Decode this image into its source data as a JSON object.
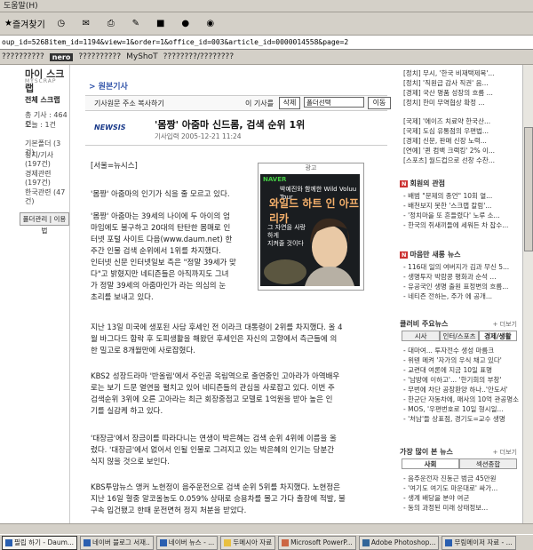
{
  "menubar": {
    "help": "도움말(H)"
  },
  "toolbar": {
    "favorites": "즐겨찾기"
  },
  "address": {
    "url": "oup_id=5268item_id=1194&view=1&order=1&office_id=003&article_id=0000014558&page=2"
  },
  "linksbar": {
    "links": [
      "??????????",
      "??????????",
      "MyShoT",
      "????????/????????"
    ],
    "nero": "nero"
  },
  "left": {
    "title": "마이 스크랩",
    "subtitle": "MYSCRAP",
    "all": "전체 스크랩",
    "rows": [
      "총 기사 : 464건",
      "오늘 : 1건",
      "",
      "기본폴더 (3건)",
      "정치/기사 (197건)",
      "경제관련 (197건)",
      "한국관련 (47건)"
    ],
    "button": "폴더관리 | 이용법"
  },
  "center": {
    "section": "> 원본기사",
    "url_label": "기사원문 주소 복사하기",
    "my_label": "이 기사를",
    "delete": "삭제",
    "folder": "폴더선택",
    "move": "이동",
    "source": "NEWSIS",
    "headline": "'몸짱' 아줌마 신드롬, 검색 순위 1위",
    "dateline": "기사입력 2005-12-21 11:24",
    "paragraphs": [
      "[서울=뉴시스]",
      "'몸짱' 아줌마의 인기가 식을 줄 모르고 있다.",
      "'몸짱' 아줌마는 39세의 나이에 두 아이의 엄\n마임에도 불구하고 20대의 탄탄한 몸매로 인\n터넷 포털 사이트 다음(www.daum.net) 한\n주간 인물 검색 순위에서 1위를 차지했다.\n인터넷 신문 인터넷일보 측은 \"정말 39세가 맞\n다\"고 밝혔지만 네티즌들은 아직까지도 그녀\n가 정말 39세의 아줌마인가 라는 의심의 눈\n초리를 보내고 있다.",
      "지난 13일 미국에 생포된 사담 후세인 전 이라크 대통령이 2위를 차지했다. 올 4\n월 바그다드 함락 후 도피생활을 해왔던 후세인은 자신의 고향에서 측근들에 의\n한 밀고로 8개월만에 사로잡혔다.",
      "KBS2 성장드라마 '반올림'에서 주인공 옥림역으로 출연중인 고아라가 아역배우\n로는 보기 드문 열연을 펼치고 있어 네티즌들의 관심을 사로잡고 있다. 이번 주\n검색순위 3위에 오른 고아라는 최근 회장중점고 모델로 1억원을 받아 높은 인\n기를 실감케 하고 있다.",
      "'대장금'에서 장금이를 따라다니는 연생이 박은혜는 검색 순위 4위에 이름을 올\n렸다. '대장금'에서 없어서 인될 인물로 그려지고 있는 박은혜의 인기는 당분간\n식지 않을 것으로 보인다.",
      "KBS투맘뉴스 앵커 노현정이 음주운전으로 검색 순위 5위를 차지했다. 노현정은\n지난 16일 혈중 알코올농도 0.059% 상태로 승용차를 몰고 가다 출장에 적발, 불\n구속 입건됐고 한때 운전면허 정지 처분을 받았다."
    ],
    "ad": {
      "label": "광고",
      "logo": "NAVER",
      "line1": "박예진와 함께한 Wild Voluu Tour",
      "line2": "와일드 하트 인 아프리카",
      "line3": "그 자연을 사랑하게\n지켜줄 것이다"
    }
  },
  "right": {
    "top_items": [
      "[정치] 무시, '한국 비재택제목'...",
      "[정치] '직원급 감사 직권' 음...",
      "[경제] 국산 명품 성장의 흐름 ...",
      "[정치] 한미 무역협상 확정 ..."
    ],
    "mid_items": [
      "[국제] '에이즈 치료약 한국산...",
      "[국제] 도심 유통점의 우편법...",
      "[경제] 신문, 판매 신장 노력...",
      "[연예] '퀸 컴백 크랙킹' 2% 이...",
      "[스포츠] 월드컵으로 선창 수찬..."
    ],
    "h2": "회원의 관점",
    "h2_items": [
      "- 배범 \"문제의 종언\" 10회 열...",
      "- 배천보지 못한 '스크랩 칼럼'...",
      "- '정치마을 또 흔들렸다' 노루 소...",
      "- 한국의 쥐새끼들에 세워든 차 잡수..."
    ],
    "h3": "마음만 새롱 뉴스",
    "h3_items": [
      "- 116대 일의 여버지가 김과 무신 5...",
      "- 생명투자 박람콩 평화과 순석 ...",
      "- 유공국인 생명 출원 표정변의 흐름...",
      "- 네티즌 전하는, 주가 에 공개..."
    ],
    "h4": "클러비 주요뉴스",
    "tabs1": [
      "시사",
      "인터/스포츠",
      "경제/생활"
    ],
    "tab_items": [
      "- 대마여... 투자전수 생성 마름크",
      "- 위텐 메켜 '자가의 우식 채고 있다'",
      "- 교련대 여론에 지금 10일 표명",
      "- '남방에 이하고'... '한기회의 부창'",
      "- 무번에 차단 공장환양 하나..'안도서'",
      "- 한군단 자동차에, 매사의 10억 관공명소",
      "- MOS, '우편번호로 10일 형시일...",
      "- '처남'들 상표점, 경기도=교수 생명"
    ],
    "h5": "가장 많이 본 뉴스",
    "tabs2": [
      "사회",
      "섹션종합"
    ],
    "h5_items": [
      "- 음주운전자 진동근 범금 45만원",
      "- '여기도 여기도 마운대로' 싸가...",
      "- 생계 배당을 분야 여군",
      "- 동의 과정된 미래 상태정보..."
    ],
    "more": "+ 더보기"
  },
  "taskbar": {
    "items": [
      "필립 하기 - Daum...",
      "네이버 블로그 서재..",
      "네이버 뉴스 - ...",
      "두메시아 자료",
      "Microsoft PowerP...",
      "Adobe Photoshop...",
      "무림메이저 자료 - ..."
    ]
  }
}
